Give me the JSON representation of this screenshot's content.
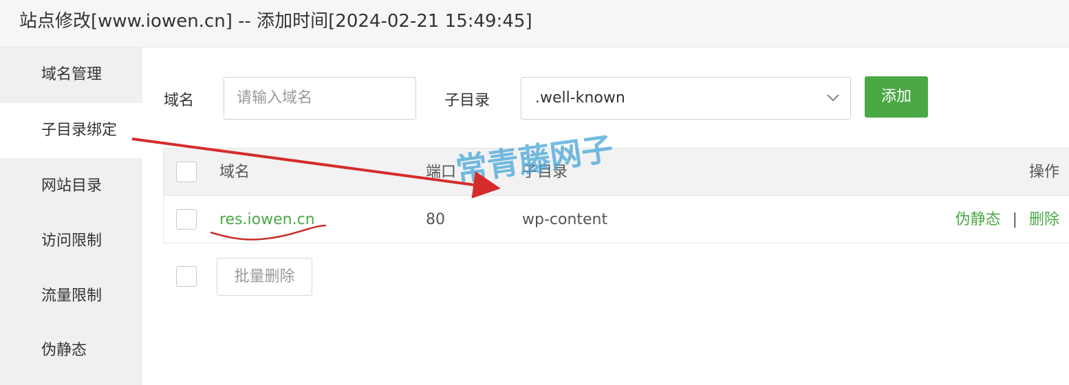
{
  "window": {
    "title": "站点修改[www.iowen.cn] -- 添加时间[2024-02-21 15:49:45]"
  },
  "sidebar": {
    "items": [
      {
        "label": "域名管理"
      },
      {
        "label": "子目录绑定",
        "active": true
      },
      {
        "label": "网站目录"
      },
      {
        "label": "访问限制"
      },
      {
        "label": "流量限制"
      },
      {
        "label": "伪静态"
      }
    ]
  },
  "form": {
    "domain_label": "域名",
    "domain_placeholder": "请输入域名",
    "subdir_label": "子目录",
    "subdir_selected": ".well-known",
    "add_button": "添加"
  },
  "table": {
    "headers": {
      "domain": "域名",
      "port": "端口",
      "subdir": "子目录",
      "actions": "操作"
    },
    "rows": [
      {
        "domain": "res.iowen.cn",
        "port": "80",
        "subdir": "wp-content",
        "action_rewrite": "伪静态",
        "separator": "|",
        "action_delete": "删除"
      }
    ]
  },
  "batch_delete_button": "批量删除",
  "watermark": "常青藤网子",
  "colors": {
    "accent_green": "#4aa845",
    "annotation_red": "#d62b2b",
    "watermark_blue": "#46a5d7"
  }
}
